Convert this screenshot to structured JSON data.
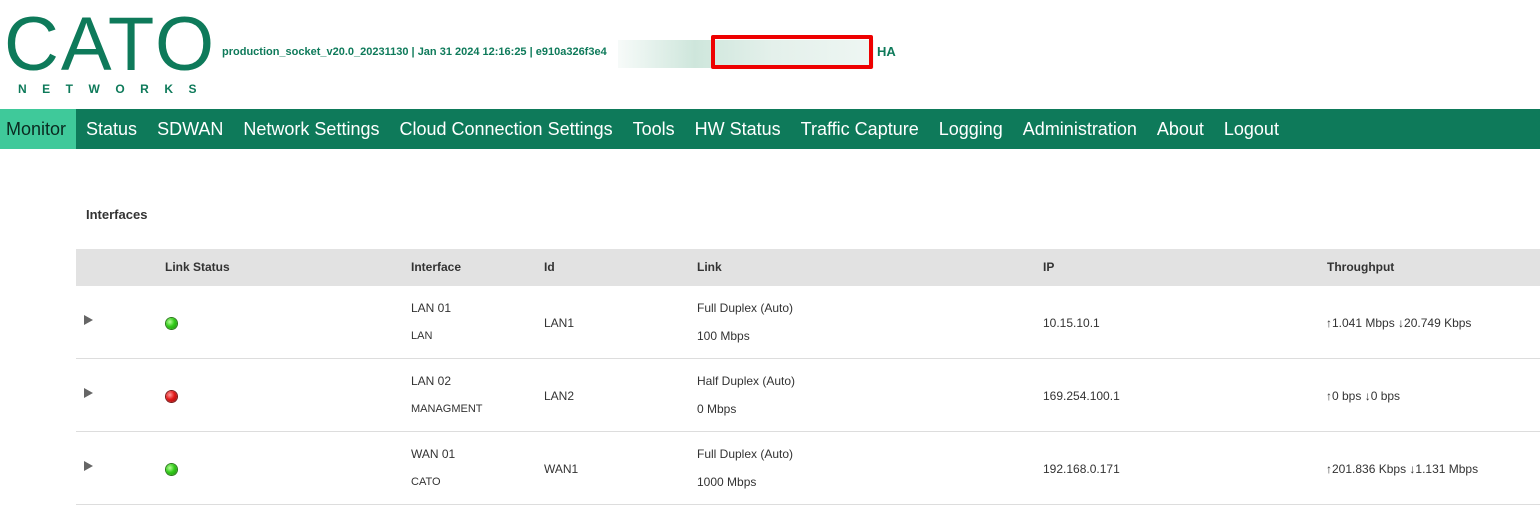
{
  "header": {
    "logo_word": "CATO",
    "logo_sub": "NETWORKS",
    "build_info": "production_socket_v20.0_20231130 | Jan 31 2024 12:16:25 | e910a326f3e4",
    "ha_label": "HA"
  },
  "nav": {
    "items": [
      "Monitor",
      "Status",
      "SDWAN",
      "Network Settings",
      "Cloud Connection Settings",
      "Tools",
      "HW Status",
      "Traffic Capture",
      "Logging",
      "Administration",
      "About",
      "Logout"
    ],
    "active": "Monitor"
  },
  "interfaces": {
    "title": "Interfaces",
    "columns": {
      "link_status": "Link Status",
      "interface": "Interface",
      "id": "Id",
      "link": "Link",
      "ip": "IP",
      "throughput": "Throughput"
    },
    "rows": [
      {
        "status": "up",
        "interface": "LAN 01",
        "role": "LAN",
        "id": "LAN1",
        "duplex": "Full Duplex (Auto)",
        "speed": "100 Mbps",
        "ip": "10.15.10.1",
        "throughput": "↑1.041 Mbps ↓20.749 Kbps"
      },
      {
        "status": "down",
        "interface": "LAN 02",
        "role": "MANAGMENT",
        "id": "LAN2",
        "duplex": "Half Duplex (Auto)",
        "speed": "0 Mbps",
        "ip": "169.254.100.1",
        "throughput": "↑0 bps ↓0 bps"
      },
      {
        "status": "up",
        "interface": "WAN 01",
        "role": "CATO",
        "id": "WAN1",
        "duplex": "Full Duplex (Auto)",
        "speed": "1000 Mbps",
        "ip": "192.168.0.171",
        "throughput": "↑201.836 Kbps ↓1.131 Mbps"
      }
    ]
  },
  "colors": {
    "brand": "#0e7a5a",
    "nav_active": "#3fc99a",
    "status_up": "#33cc1a",
    "status_down": "#e31a1a",
    "redaction": "#ee0000"
  },
  "icons": {
    "expander": "triangle-right-icon",
    "status_up": "green-led-icon",
    "status_down": "red-led-icon"
  }
}
